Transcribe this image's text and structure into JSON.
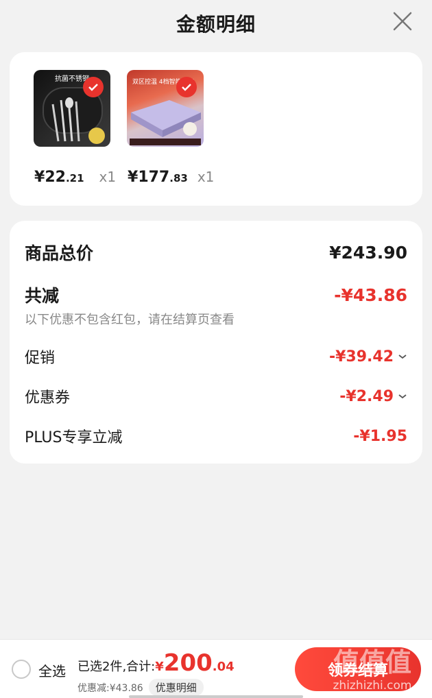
{
  "header": {
    "title": "金额明细"
  },
  "products": [
    {
      "price_yen": "¥",
      "price_int": "22",
      "price_dec": ".21",
      "qty": "x1",
      "image_text": "抗菌不锈钢"
    },
    {
      "price_yen": "¥",
      "price_int": "177",
      "price_dec": ".83",
      "qty": "x1",
      "image_text": "双区控温\n4档智能温控"
    }
  ],
  "summary": {
    "total_label": "商品总价",
    "total_value": "¥243.90",
    "reduce_label": "共减",
    "reduce_value": "-¥43.86",
    "hint": "以下优惠不包含红包，请在结算页查看",
    "promo_label": "促销",
    "promo_value": "-¥39.42",
    "coupon_label": "优惠券",
    "coupon_value": "-¥2.49",
    "plus_label": "PLUS专享立减",
    "plus_value": "-¥1.95"
  },
  "footer": {
    "select_all": "全选",
    "selected_text": "已选2件,合计:",
    "total_yen": "¥",
    "total_int": "200",
    "total_dec": ".04",
    "discount_text": "优惠减:¥43.86",
    "detail_button": "优惠明细",
    "checkout_button": "领券结算"
  },
  "watermark": {
    "text": "值值值",
    "url": "zhizhizhi.com"
  },
  "colors": {
    "accent_red": "#e8332d",
    "card_bg": "#ffffff",
    "page_bg": "#f2f2f2"
  }
}
